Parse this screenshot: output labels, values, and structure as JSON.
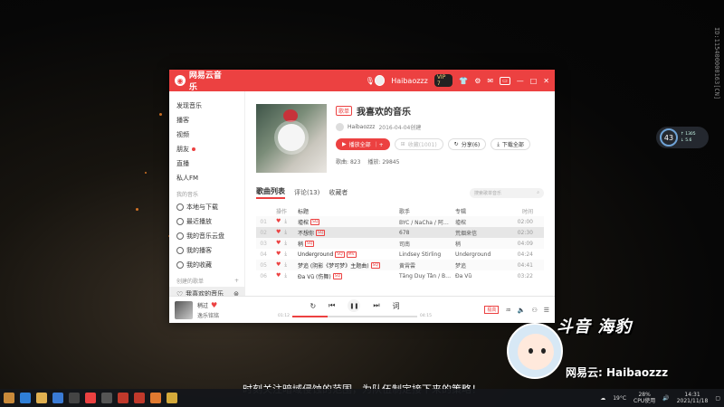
{
  "watermark": "ID:115400000163[CN]",
  "app": {
    "title": "网易云音乐",
    "username": "Haibaozzz",
    "vip_label": "VIP 7"
  },
  "sidebar": {
    "items": [
      {
        "label": "发现音乐"
      },
      {
        "label": "播客"
      },
      {
        "label": "视频"
      },
      {
        "label": "朋友"
      },
      {
        "label": "直播"
      },
      {
        "label": "私人FM"
      }
    ],
    "my_music_title": "我的音乐",
    "my_music": [
      {
        "label": "本地与下载",
        "icon": "download-icon"
      },
      {
        "label": "最近播放",
        "icon": "clock-icon"
      },
      {
        "label": "我的音乐云盘",
        "icon": "cloud-icon"
      },
      {
        "label": "我的播客",
        "icon": "radio-icon"
      },
      {
        "label": "我的收藏",
        "icon": "star-icon"
      }
    ],
    "created_title": "创建的歌单",
    "created": [
      {
        "label": "我喜欢的音乐",
        "icon": "heart-icon"
      }
    ]
  },
  "playlist": {
    "tag": "歌单",
    "title": "我喜欢的音乐",
    "creator": "Haibaozzz",
    "created_date": "2016-04-04创建",
    "play_all": "播放全部",
    "collect": "收藏(1001)",
    "share": "分享(6)",
    "download_all": "下载全部",
    "songs_label": "歌曲",
    "songs_count": "823",
    "plays_label": "播放",
    "plays_count": "29845"
  },
  "tabs": [
    "歌曲列表",
    "评论(13)",
    "收藏者"
  ],
  "search_placeholder": "搜索歌单音乐",
  "table": {
    "headers": {
      "op": "操作",
      "title": "标题",
      "artist": "歌手",
      "album": "专辑",
      "time": "时间"
    },
    "rows": [
      {
        "idx": "01",
        "title": "墟棺",
        "badges": [
          "SQ"
        ],
        "artist": "BYC / NaCha / 阿…",
        "album": "墟棺",
        "time": "02:00"
      },
      {
        "idx": "02",
        "title": "不想你",
        "badges": [
          "SQ"
        ],
        "artist": "678",
        "album": "荒烟来信",
        "time": "02:30"
      },
      {
        "idx": "03",
        "title": "稍",
        "badges": [
          "SQ"
        ],
        "artist": "司南",
        "album": "稍",
        "time": "04:09"
      },
      {
        "idx": "04",
        "title": "Underground",
        "badges": [
          "SQ",
          "MV"
        ],
        "artist": "Lindsey Stirling",
        "album": "Underground",
        "time": "04:24"
      },
      {
        "idx": "05",
        "title": "梦追 (阴影《梦可梦》主题曲)",
        "badges": [
          "SQ"
        ],
        "artist": "黄霄雲",
        "album": "梦追",
        "time": "04:41"
      },
      {
        "idx": "06",
        "title": "Đa Vũ (伤舞)",
        "badges": [
          "SQ"
        ],
        "artist": "Tăng Duy Tân / B…",
        "album": "Đa Vũ",
        "time": "03:22"
      }
    ]
  },
  "player": {
    "song": "稍过",
    "artist": "逸乐铭铭",
    "elapsed": "01:12",
    "duration": "04:15",
    "progress": 0.28,
    "quality": "极高"
  },
  "widget": {
    "percent": "43",
    "up": "↑ 1305",
    "down": "↓ 5.6"
  },
  "subtitle": "时刻关注暗域侵蚀的范围，为队伍制定接下来的策略！",
  "streamer": {
    "netease_id": "网易云: Haibaozzz"
  },
  "taskbar": {
    "weather": "19°C",
    "cpu": "28%",
    "cpu_label": "CPU使用",
    "time": "14:31",
    "date": "2021/11/18"
  },
  "colors": {
    "accent": "#ec4141"
  }
}
